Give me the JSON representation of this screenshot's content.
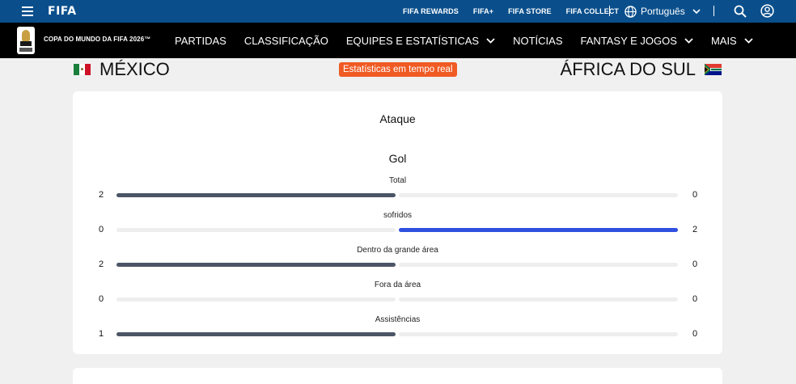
{
  "topbar": {
    "brand": "FIFA",
    "links": [
      "FIFA REWARDS",
      "FIFA+",
      "FIFA STORE",
      "FIFA COLLECT"
    ],
    "language": "Português",
    "icons": [
      "menu-icon",
      "globe-icon",
      "chevron-down-icon",
      "search-icon",
      "user-icon"
    ]
  },
  "nav": {
    "tournament": "COPA DO MUNDO DA FIFA 2026™",
    "items": [
      {
        "label": "PARTIDAS",
        "dropdown": false
      },
      {
        "label": "CLASSIFICAÇÃO",
        "dropdown": false
      },
      {
        "label": "EQUIPES E ESTATÍSTICAS",
        "dropdown": true
      },
      {
        "label": "NOTÍCIAS",
        "dropdown": false
      },
      {
        "label": "FANTASY E JOGOS",
        "dropdown": true
      },
      {
        "label": "MAIS",
        "dropdown": true
      }
    ]
  },
  "match": {
    "home_team": "MÉXICO",
    "away_team": "ÁFRICA DO SUL",
    "live_badge": "Estatísticas em tempo real",
    "colors": {
      "badge": "#f05a23",
      "home_bar": "#4b5566",
      "away_bar": "#2f4fe0"
    }
  },
  "stats": {
    "section": "Ataque",
    "group": "Gol",
    "rows": [
      {
        "label": "Total",
        "home": "2",
        "away": "0",
        "home_share": 1.0,
        "away_share": 0.0
      },
      {
        "label": "sofridos",
        "home": "0",
        "away": "2",
        "home_share": 0.0,
        "away_share": 1.0
      },
      {
        "label": "Dentro da grande área",
        "home": "2",
        "away": "0",
        "home_share": 1.0,
        "away_share": 0.0
      },
      {
        "label": "Fora da área",
        "home": "0",
        "away": "0",
        "home_share": 0.0,
        "away_share": 0.0
      },
      {
        "label": "Assistências",
        "home": "1",
        "away": "0",
        "home_share": 1.0,
        "away_share": 0.0
      }
    ]
  }
}
